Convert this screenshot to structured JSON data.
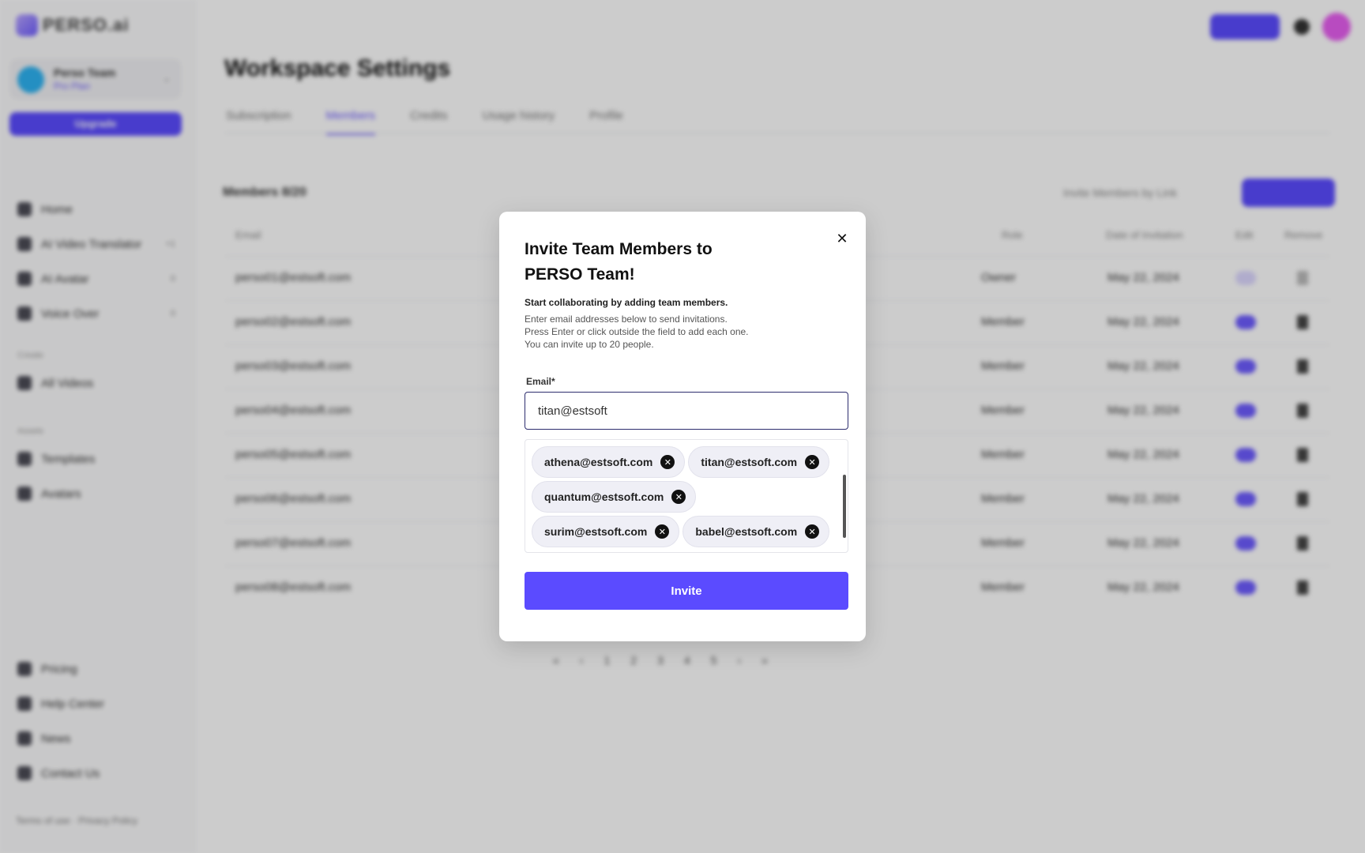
{
  "sidebar": {
    "logo": "PERSO.ai",
    "profile": {
      "name": "Perso Team",
      "sub": "Pro Plan"
    },
    "upgrade_label": "Upgrade",
    "items": [
      {
        "label": "Home"
      },
      {
        "label": "AI Video Translator",
        "badge": "+1"
      },
      {
        "label": "AI Avatar",
        "badge": "0"
      },
      {
        "label": "Voice Over",
        "badge": "0"
      }
    ],
    "section1": "Create",
    "section1_items": [
      {
        "label": "All Videos"
      }
    ],
    "section2": "Assets",
    "section2_items": [
      {
        "label": "Templates"
      },
      {
        "label": "Avatars"
      }
    ],
    "bottom_items": [
      {
        "label": "Pricing"
      },
      {
        "label": "Help Center"
      },
      {
        "label": "News"
      },
      {
        "label": "Contact Us"
      }
    ],
    "footer": "Terms of use · Privacy Policy"
  },
  "page": {
    "title": "Workspace Settings",
    "tabs": [
      "Subscription",
      "Members",
      "Credits",
      "Usage history",
      "Profile"
    ],
    "members_count": "Members 8/20",
    "invite_link": "Invite Members by Link",
    "columns": {
      "email": "Email",
      "role": "Role",
      "date": "Date of Invitation",
      "edit": "Edit",
      "remove": "Remove"
    },
    "rows": [
      {
        "email": "perso01@estsoft.com",
        "role": "Owner",
        "date": "May 22, 2024"
      },
      {
        "email": "perso02@estsoft.com",
        "role": "Member",
        "date": "May 22, 2024"
      },
      {
        "email": "perso03@estsoft.com",
        "role": "Member",
        "date": "May 22, 2024"
      },
      {
        "email": "perso04@estsoft.com",
        "role": "Member",
        "date": "May 22, 2024"
      },
      {
        "email": "perso05@estsoft.com",
        "role": "Member",
        "date": "May 22, 2024"
      },
      {
        "email": "perso06@estsoft.com",
        "role": "Member",
        "date": "May 22, 2024"
      },
      {
        "email": "perso07@estsoft.com",
        "role": "Member",
        "date": "May 22, 2024"
      },
      {
        "email": "perso08@estsoft.com",
        "role": "Member",
        "date": "May 22, 2024"
      }
    ],
    "pager": [
      "«",
      "‹",
      "1",
      "2",
      "3",
      "4",
      "5",
      "›",
      "»"
    ]
  },
  "modal": {
    "title": "Invite Team Members to PERSO Team!",
    "desc_strong": "Start collaborating by adding team members.",
    "desc_lines": [
      "Enter email addresses below to send invitations.",
      "Press Enter or click outside the field to add each one.",
      "You can invite up to 20 people."
    ],
    "email_label": "Email*",
    "email_value": "titan@estsoft",
    "chips": [
      "athena@estsoft.com",
      "titan@estsoft.com",
      "quantum@estsoft.com",
      "surim@estsoft.com",
      "babel@estsoft.com"
    ],
    "invite_label": "Invite",
    "close_glyph": "✕",
    "chip_remove_glyph": "✕"
  },
  "colors": {
    "accent": "#5b4bff",
    "overlay": "rgba(0,0,0,0.2)"
  }
}
